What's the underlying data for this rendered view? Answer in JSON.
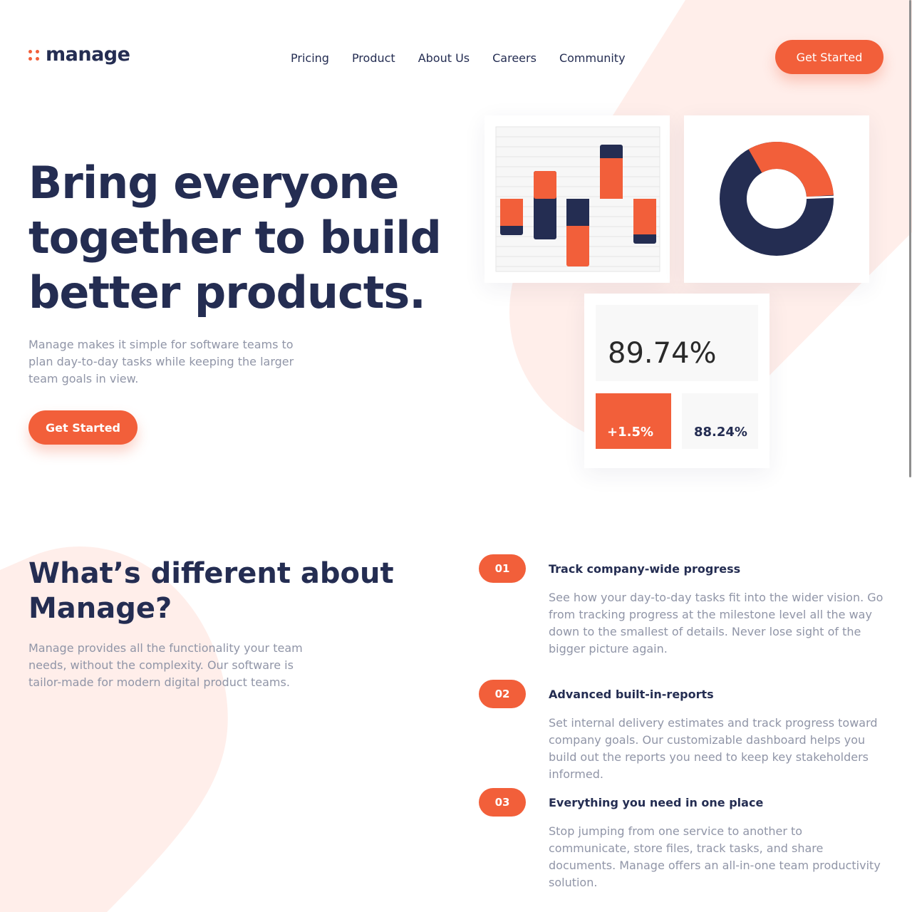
{
  "brand": {
    "name": "manage",
    "accent": "#F25F3A",
    "navy": "#242D52",
    "muted": "#9095A7",
    "pale": "#FFEEEA"
  },
  "nav": {
    "items": [
      "Pricing",
      "Product",
      "About Us",
      "Careers",
      "Community"
    ],
    "cta": "Get Started"
  },
  "hero": {
    "title_lines": [
      "Bring everyone",
      "together to build",
      "better products."
    ],
    "description": "Manage makes it simple for software teams to plan day-to-day tasks while keeping the larger team goals in view.",
    "cta": "Get Started"
  },
  "dashboard": {
    "main_stat": "89.74%",
    "change_stat": "+1.5%",
    "secondary_stat": "88.24%"
  },
  "features": {
    "title": "What’s different about Manage?",
    "description": "Manage provides all the functionality your team needs, without the complexity. Our software is tailor-made for modern digital product teams.",
    "items": [
      {
        "number": "01",
        "title": "Track company-wide progress",
        "description": "See how your day-to-day tasks fit into the wider vision. Go from tracking progress at the milestone level all the way down to the smallest of details. Never lose sight of the bigger picture again."
      },
      {
        "number": "02",
        "title": "Advanced built-in-reports",
        "description": "Set internal delivery estimates and track progress toward company goals. Our customizable dashboard helps you build out the reports you need to keep key stakeholders informed."
      },
      {
        "number": "03",
        "title": "Everything you need in one place",
        "description": "Stop jumping from one service to another to communicate, store files, track tasks, and share documents. Manage offers an all-in-one team productivity solution."
      }
    ]
  }
}
